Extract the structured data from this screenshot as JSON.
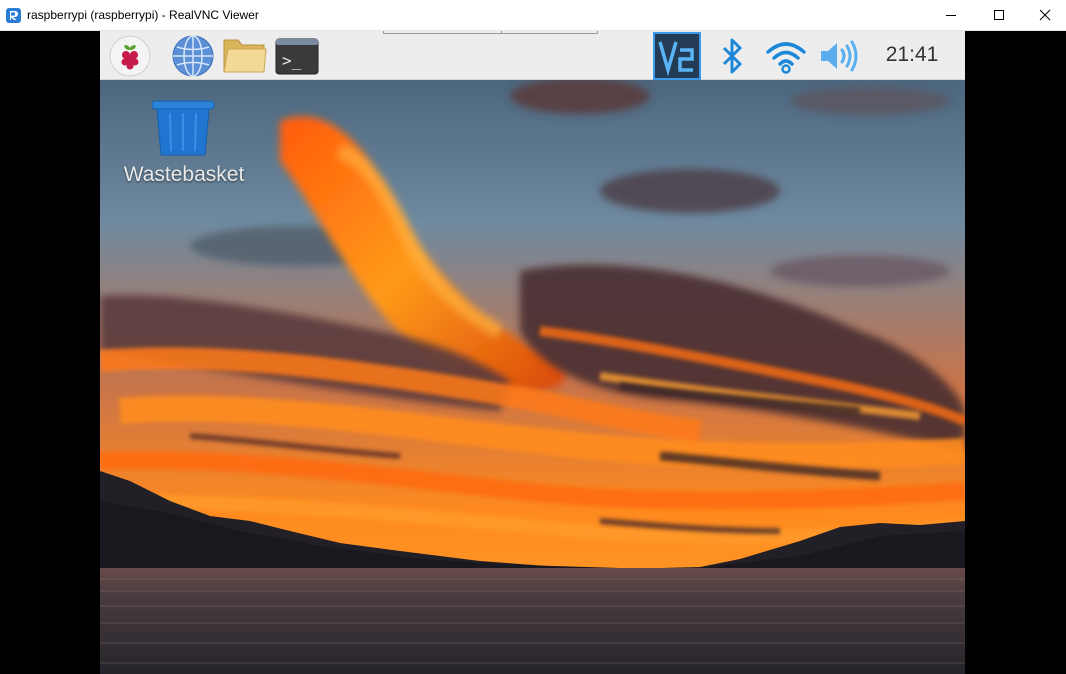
{
  "window": {
    "title": "raspberrypi (raspberrypi) - RealVNC Viewer",
    "app_icon": "realvnc-viewer-icon",
    "controls": [
      "minimize-icon",
      "maximize-icon",
      "close-icon"
    ]
  },
  "taskbar": {
    "launchers": [
      {
        "name": "raspberry-menu",
        "icon": "raspberry-icon"
      },
      {
        "name": "web-browser",
        "icon": "globe-icon"
      },
      {
        "name": "file-manager",
        "icon": "folder-icon"
      },
      {
        "name": "terminal",
        "icon": "terminal-icon",
        "glyph": ">_"
      }
    ],
    "tray": {
      "vnc": {
        "icon": "vnc-icon",
        "glyph": "V2"
      },
      "bluetooth": {
        "icon": "bluetooth-icon"
      },
      "wifi": {
        "icon": "wifi-icon"
      },
      "volume": {
        "icon": "volume-icon"
      },
      "clock": "21:41"
    }
  },
  "desktop": {
    "icons": [
      {
        "label": "Wastebasket",
        "icon": "wastebasket-icon"
      }
    ],
    "wallpaper": "sunset-over-lake"
  },
  "colors": {
    "taskbar_bg": "#ededed",
    "accent_blue": "#1e88d8",
    "vnc_bg": "#2d3e50",
    "sky_top": "#4f6d84",
    "cloud_orange": "#ff7a14",
    "water": "#3a3538"
  }
}
